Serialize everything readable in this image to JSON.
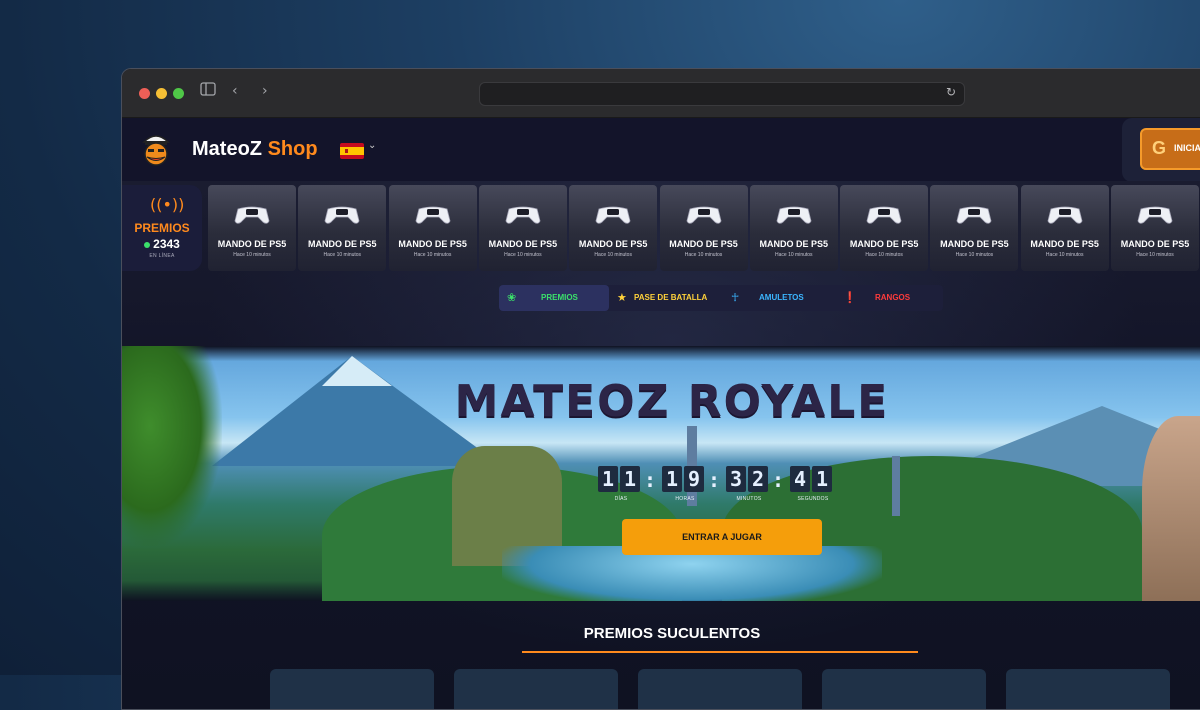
{
  "browser": {
    "url": "",
    "reload_icon": "reload-icon"
  },
  "header": {
    "brand_main": "MateoZ",
    "brand_accent": "Shop",
    "language": "spain-flag",
    "login_label": "INICIAR"
  },
  "ticker": {
    "live_label": "PREMIOS",
    "live_count": "2343",
    "live_sub": "EN LÍNEA",
    "items": [
      {
        "name": "MANDO DE PS5",
        "time": "Hace 10 minutos"
      },
      {
        "name": "MANDO DE PS5",
        "time": "Hace 10 minutos"
      },
      {
        "name": "MANDO DE PS5",
        "time": "Hace 10 minutos"
      },
      {
        "name": "MANDO DE PS5",
        "time": "Hace 10 minutos"
      },
      {
        "name": "MANDO DE PS5",
        "time": "Hace 10 minutos"
      },
      {
        "name": "MANDO DE PS5",
        "time": "Hace 10 minutos"
      },
      {
        "name": "MANDO DE PS5",
        "time": "Hace 10 minutos"
      },
      {
        "name": "MANDO DE PS5",
        "time": "Hace 10 minutos"
      },
      {
        "name": "MANDO DE PS5",
        "time": "Hace 10 minutos"
      },
      {
        "name": "MANDO DE PS5",
        "time": "Hace 10 minutos"
      },
      {
        "name": "MANDO DE PS5",
        "time": "Hace 10 minutos"
      }
    ]
  },
  "tabs": [
    {
      "label": "PREMIOS",
      "color": "#3be16b",
      "icon": "laurel-icon"
    },
    {
      "label": "PASE DE BATALLA",
      "color": "#ffd23a",
      "icon": "star-icon"
    },
    {
      "label": "AMULETOS",
      "color": "#3bb6ff",
      "icon": "ankh-icon"
    },
    {
      "label": "RANGOS",
      "color": "#ff3b3b",
      "icon": "rank-icon"
    }
  ],
  "hero": {
    "title": "MATEOZ ROYALE",
    "countdown": {
      "days": "11",
      "hours": "19",
      "minutes": "32",
      "seconds": "41",
      "days_label": "DÍAS",
      "hours_label": "HORAS",
      "minutes_label": "MINUTOS",
      "seconds_label": "SEGUNDOS"
    },
    "cta_label": "ENTRAR A JUGAR"
  },
  "section": {
    "title": "PREMIOS SUCULENTOS"
  },
  "colors": {
    "accent": "#ff8a1d",
    "cta": "#f59e0b"
  }
}
